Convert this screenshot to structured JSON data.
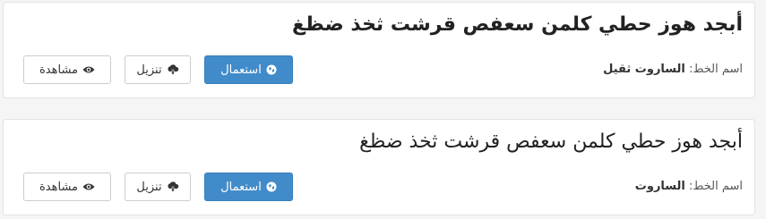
{
  "fonts": [
    {
      "sample_text": "أبجد هوز حطي كلمن سعفص قرشت ثخذ ضظغ",
      "font_label": "اسم الخط:",
      "font_name": "الساروت ثقيل",
      "use_label": "استعمال",
      "download_label": "تنزيل",
      "view_label": "مشاهدة"
    },
    {
      "sample_text": "أبجد هوز حطي كلمن سعفص قرشت ثخذ ضظغ",
      "font_label": "اسم الخط:",
      "font_name": "الساروت",
      "use_label": "استعمال",
      "download_label": "تنزيل",
      "view_label": "مشاهدة"
    }
  ],
  "icons": {
    "use": "globe-icon",
    "download": "cloud-download-icon",
    "view": "eye-icon"
  },
  "colors": {
    "primary": "#428bca",
    "background": "#f5f5f5"
  }
}
